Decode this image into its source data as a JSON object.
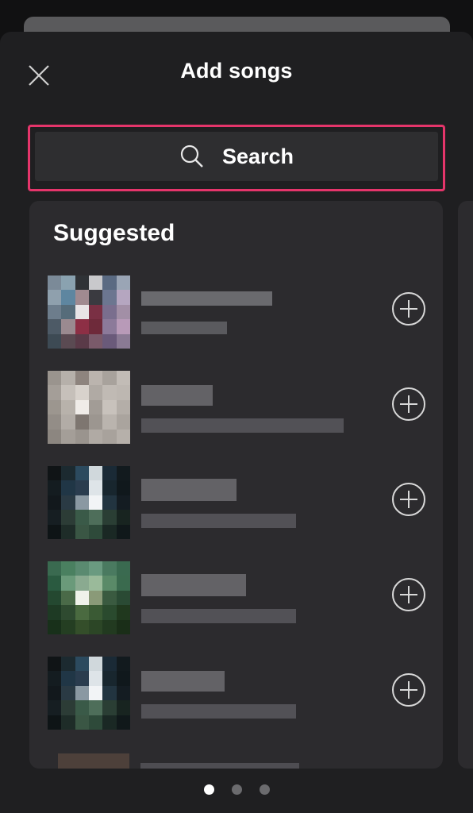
{
  "header": {
    "title": "Add songs",
    "close_icon": "close-icon"
  },
  "search": {
    "label": "Search",
    "icon": "search-icon",
    "highlight_color": "#e5356b"
  },
  "suggested": {
    "heading": "Suggested",
    "items_note": "track titles and artists are pixelated/unreadable in the screenshot",
    "add_icon": "plus-circle-icon"
  },
  "pagination": {
    "total": 3,
    "active_index": 0
  }
}
